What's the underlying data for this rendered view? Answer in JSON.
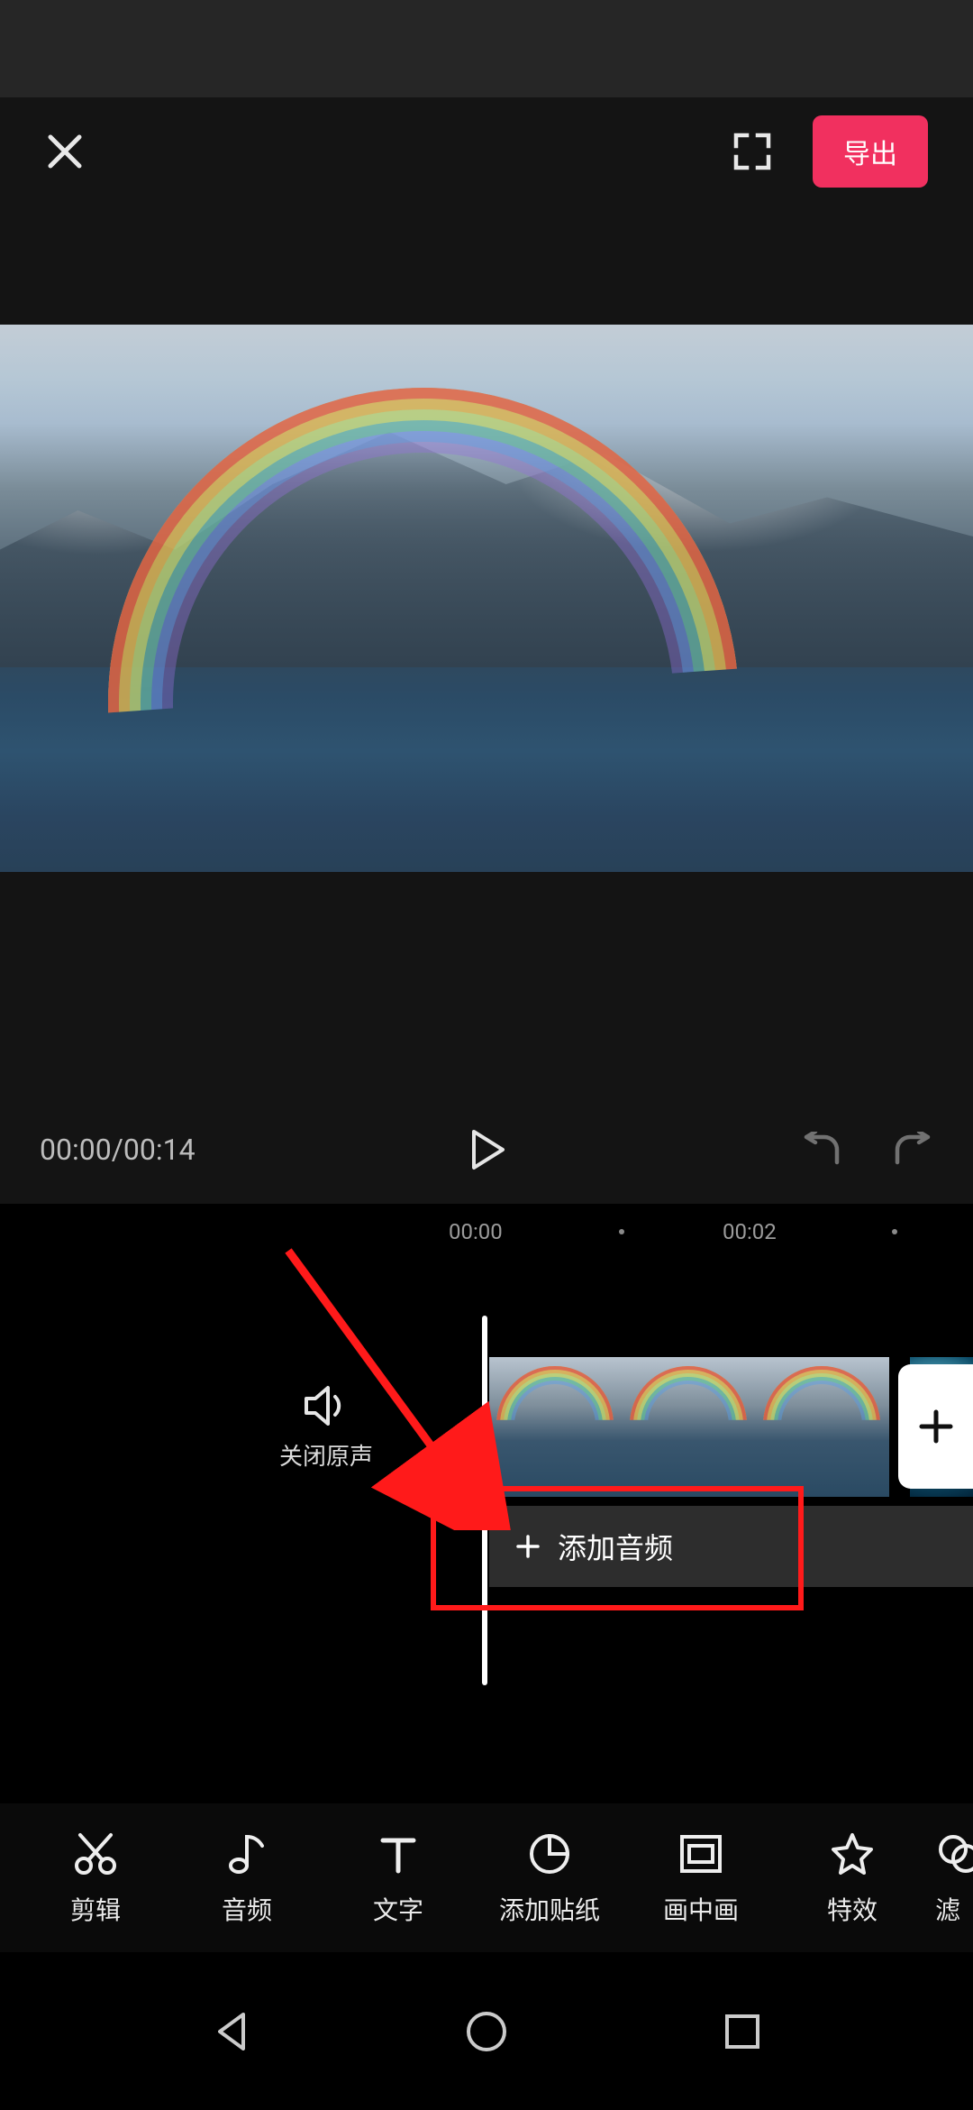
{
  "header": {
    "export_label": "导出"
  },
  "playback": {
    "current_time": "00:00",
    "total_time": "00:14"
  },
  "ruler": {
    "marks": [
      "00:00",
      "00:02"
    ]
  },
  "mute": {
    "label": "关闭原声"
  },
  "audio_track": {
    "add_label": "添加音频"
  },
  "tools": [
    {
      "key": "cut",
      "label": "剪辑",
      "icon": "scissors-icon"
    },
    {
      "key": "audio",
      "label": "音频",
      "icon": "music-note-icon"
    },
    {
      "key": "text",
      "label": "文字",
      "icon": "text-icon"
    },
    {
      "key": "sticker",
      "label": "添加贴纸",
      "icon": "sticker-icon"
    },
    {
      "key": "pip",
      "label": "画中画",
      "icon": "pip-icon"
    },
    {
      "key": "effect",
      "label": "特效",
      "icon": "star-icon"
    },
    {
      "key": "filter",
      "label": "滤",
      "icon": "filter-icon"
    }
  ],
  "colors": {
    "accent": "#f1305f",
    "annotation": "#ff1a1a"
  }
}
